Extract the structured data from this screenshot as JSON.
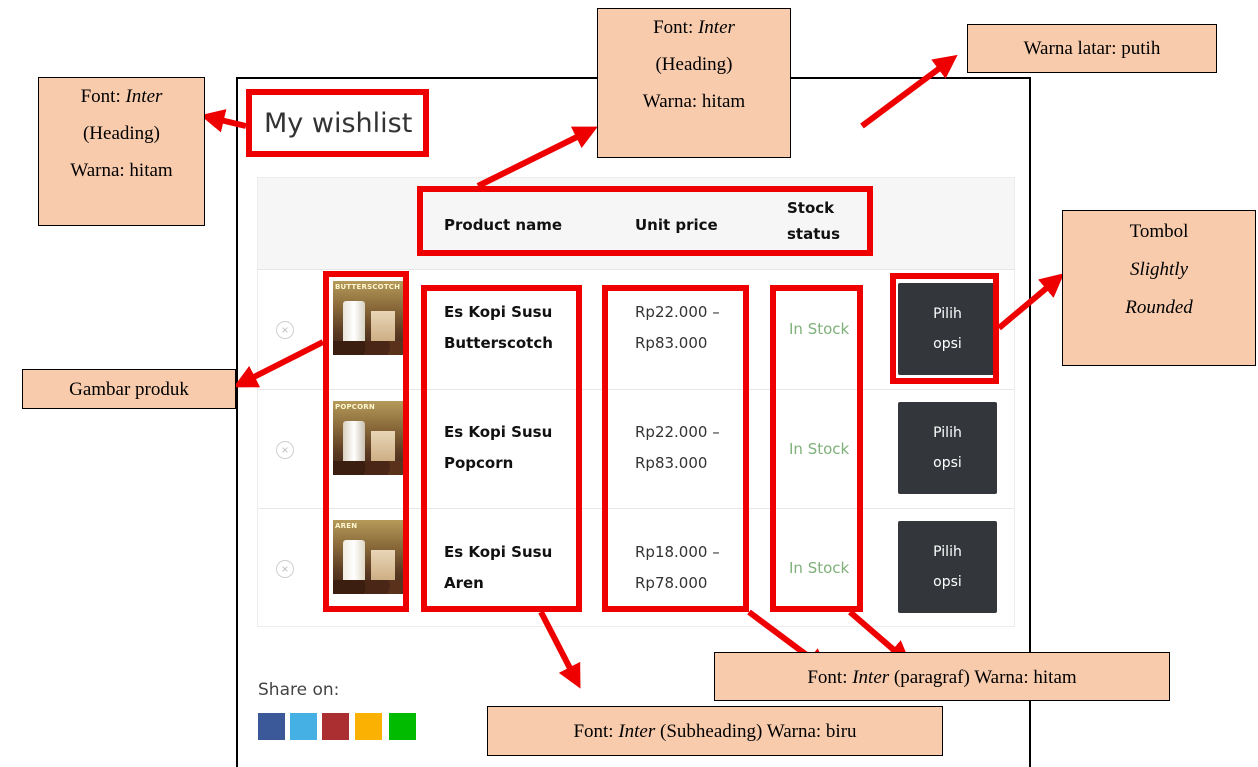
{
  "page": {
    "title": "My wishlist"
  },
  "table": {
    "headers": {
      "product_name": "Product name",
      "unit_price": "Unit price",
      "stock_status_1": "Stock",
      "stock_status_2": "status"
    },
    "rows": [
      {
        "remove": "×",
        "thumb_label": "BUTTERSCOTCH",
        "name_1": "Es Kopi Susu",
        "name_2": "Butterscotch",
        "price_1": "Rp22.000 –",
        "price_2": "Rp83.000",
        "stock": "In Stock",
        "button_1": "Pilih",
        "button_2": "opsi"
      },
      {
        "remove": "×",
        "thumb_label": "POPCORN",
        "name_1": "Es Kopi Susu",
        "name_2": "Popcorn",
        "price_1": "Rp22.000 –",
        "price_2": "Rp83.000",
        "stock": "In Stock",
        "button_1": "Pilih",
        "button_2": "opsi"
      },
      {
        "remove": "×",
        "thumb_label": "AREN",
        "name_1": "Es Kopi Susu",
        "name_2": "Aren",
        "price_1": "Rp18.000 –",
        "price_2": "Rp78.000",
        "stock": "In Stock",
        "button_1": "Pilih",
        "button_2": "opsi"
      }
    ]
  },
  "share": {
    "label": "Share on:",
    "icons": [
      {
        "name": "facebook-share-icon",
        "color": "#3b5998"
      },
      {
        "name": "twitter-share-icon",
        "color": "#45b0e3"
      },
      {
        "name": "pinterest-share-icon",
        "color": "#ab2e31"
      },
      {
        "name": "email-share-icon",
        "color": "#fbb102"
      },
      {
        "name": "whatsapp-share-icon",
        "color": "#00bb00"
      }
    ]
  },
  "annotations": {
    "heading_left": {
      "line1_prefix": "Font: ",
      "line1_italic": "Inter",
      "line2": "(Heading)",
      "line3": "Warna: hitam"
    },
    "heading_top": {
      "line1_prefix": "Font: ",
      "line1_italic": "Inter",
      "line2": "(Heading)",
      "line3": "Warna: hitam"
    },
    "background": {
      "text": "Warna latar: putih"
    },
    "button": {
      "line1": "Tombol",
      "line2_italic": "Slightly",
      "line3_italic": "Rounded"
    },
    "image": {
      "text": "Gambar produk"
    },
    "paragraph": {
      "prefix": "Font: ",
      "italic": "Inter",
      "suffix": " (paragraf) Warna: hitam"
    },
    "subheading": {
      "prefix": "Font: ",
      "italic": "Inter",
      "suffix": " (Subheading) Warna: biru"
    }
  },
  "colors": {
    "highlight": "#ee0000",
    "note_bg": "#f8cbad",
    "button_bg": "#33373b",
    "stock_green": "#7fb07a"
  }
}
